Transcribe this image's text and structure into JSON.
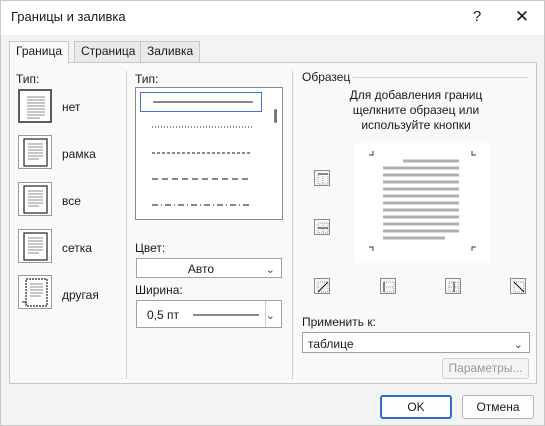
{
  "window": {
    "title": "Границы и заливка",
    "help_glyph": "?",
    "close_glyph": "✕"
  },
  "tabs": [
    {
      "label": "Граница",
      "active": true
    },
    {
      "label": "Страница",
      "active": false
    },
    {
      "label": "Заливка",
      "active": false
    }
  ],
  "setting": {
    "label": "Тип:",
    "items": [
      {
        "label": "нет",
        "icon": "none-border-icon",
        "selected": true
      },
      {
        "label": "рамка",
        "icon": "box-border-icon",
        "selected": false
      },
      {
        "label": "все",
        "icon": "all-border-icon",
        "selected": false
      },
      {
        "label": "сетка",
        "icon": "grid-border-icon",
        "selected": false
      },
      {
        "label": "другая",
        "icon": "custom-border-icon",
        "selected": false
      }
    ]
  },
  "style": {
    "label": "Тип:",
    "items": [
      "solid",
      "dotted",
      "dashed-small",
      "dashed-large",
      "dash-dot"
    ],
    "selected": "solid"
  },
  "color": {
    "label": "Цвет:",
    "value": "Авто"
  },
  "width": {
    "label": "Ширина:",
    "value": "0,5 пт"
  },
  "preview": {
    "label": "Образец",
    "instructions": [
      "Для добавления границ",
      "щелкните образец или",
      "используйте кнопки"
    ],
    "buttons": [
      "border-top-icon",
      "border-inside-horizontal-icon",
      "border-bottom-icon",
      "border-diagonal-up-icon",
      "border-left-icon",
      "border-inside-vertical-icon",
      "border-right-icon",
      "border-diagonal-down-icon"
    ]
  },
  "apply_to": {
    "label": "Применить к:",
    "value": "таблице"
  },
  "buttons": {
    "options": "Параметры...",
    "ok": "OK",
    "cancel": "Отмена"
  }
}
